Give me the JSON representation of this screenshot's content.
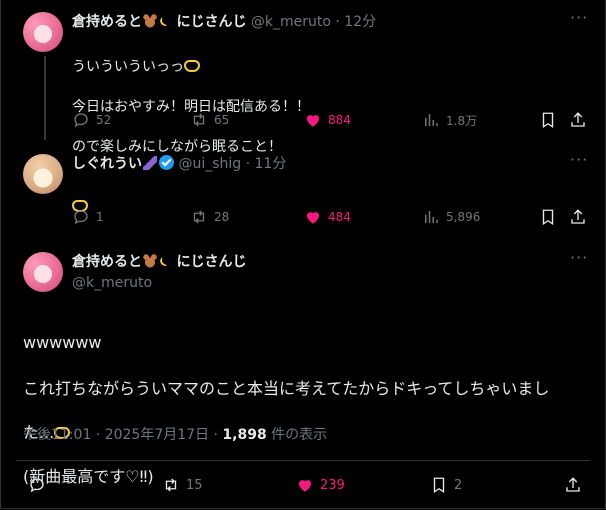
{
  "tweet1": {
    "name": "倉持めると",
    "suffix": "にじさんじ",
    "handle": "@k_meruto",
    "time": "· 12分",
    "line1": "ういういういっっ",
    "line2": "今日はおやすみ！明日は配信ある！！",
    "line3": "ので楽しみにしながら眠ること！",
    "replies": "52",
    "reposts": "65",
    "likes": "884",
    "views": "1.8万"
  },
  "tweet2": {
    "name": "しぐれうい",
    "handle": "@ui_shig",
    "time": "· 11分",
    "replies": "1",
    "reposts": "28",
    "likes": "484",
    "views": "5,896"
  },
  "tweet3": {
    "name": "倉持めると",
    "suffix": "にじさんじ",
    "handle": "@k_meruto",
    "line1": "wwwwww",
    "line2": "これ打ちながらういママのこと本当に考えてたからドキってしちゃいまし",
    "line3": "た...",
    "line4": "(新曲最高です♡‼)",
    "timestamp": "午後11:01 · 2025年7月17日 · ",
    "views_count": "1,898",
    "views_label": " 件の表示",
    "replies": "",
    "reposts": "15",
    "likes": "239",
    "bookmarks": "2"
  },
  "icons": [
    "reply-icon",
    "repost-icon",
    "like-icon",
    "views-icon",
    "bookmark-icon",
    "share-icon",
    "more-icon",
    "verified-icon"
  ],
  "colors": {
    "background": "#000000",
    "text": "#e7e9ea",
    "muted": "#71767b",
    "like": "#f91880",
    "verified": "#1d9bf0"
  }
}
